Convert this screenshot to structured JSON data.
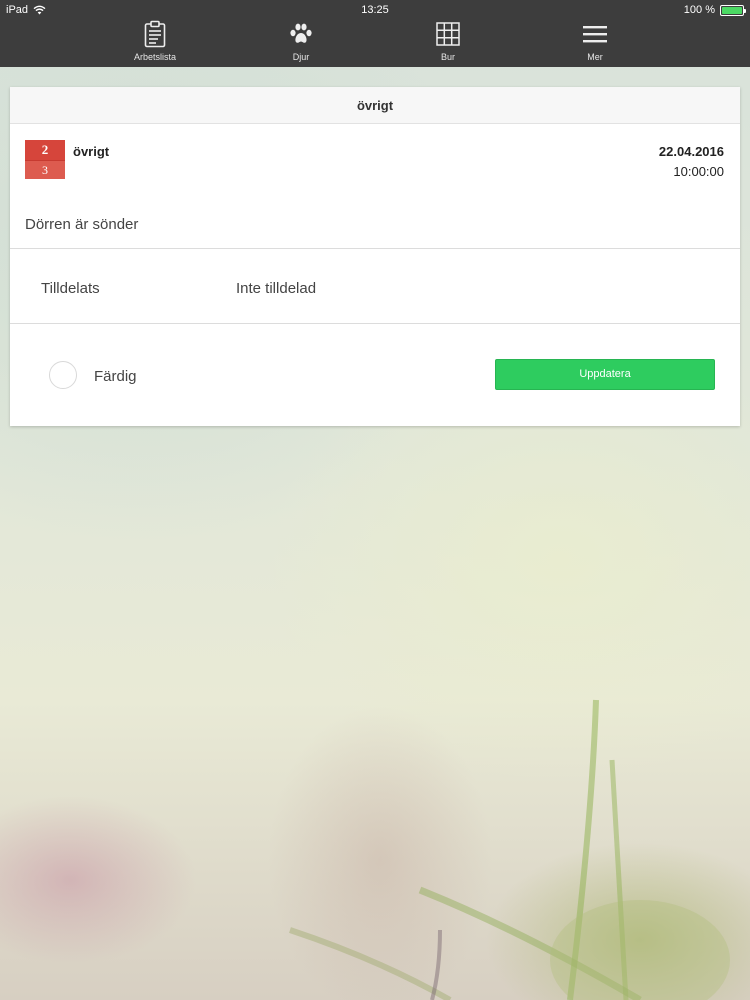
{
  "status_bar": {
    "device": "iPad",
    "time": "13:25",
    "battery": "100 %"
  },
  "nav": {
    "tabs": [
      {
        "label": "Arbetslista",
        "icon": "clipboard-icon"
      },
      {
        "label": "Djur",
        "icon": "paw-icon"
      },
      {
        "label": "Bur",
        "icon": "grid-icon"
      },
      {
        "label": "Mer",
        "icon": "menu-icon"
      }
    ]
  },
  "card": {
    "header": "övrigt",
    "calendar_icon": {
      "top": "2",
      "bottom": "3"
    },
    "title": "övrigt",
    "date": "22.04.2016",
    "time": "10:00:00",
    "description": "Dörren är sönder",
    "assigned_label": "Tilldelats",
    "assigned_value": "Inte tilldelad",
    "done_label": "Färdig",
    "update_button": "Uppdatera"
  },
  "colors": {
    "nav_bg": "#3d3d3d",
    "accent_green": "#2ecc5f",
    "calendar_red": "#d6453b",
    "battery_green": "#4cd964"
  }
}
